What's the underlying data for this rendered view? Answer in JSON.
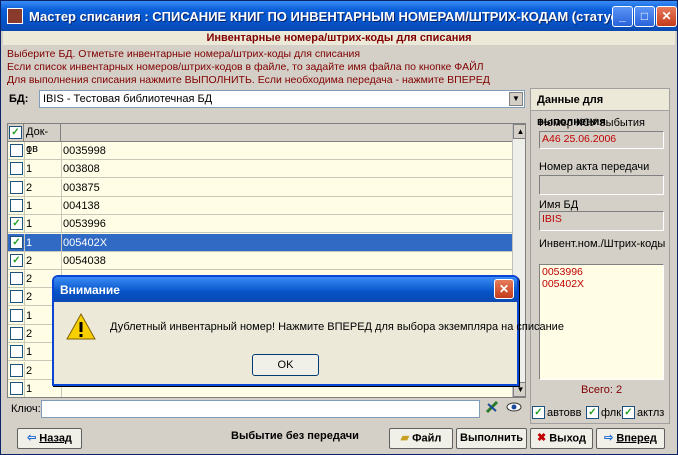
{
  "window": {
    "title": "Мастер списания : СПИСАНИЕ КНИГ ПО ИНВЕНТАРНЫМ НОМЕРАМ/ШТРИХ-КОДАМ (статус 0)",
    "min_label": "_",
    "max_label": "□",
    "close_label": "✕"
  },
  "header": "Инвентарные номера/штрих-коды для списания",
  "instructions": [
    "Выберите БД. Отметьте инвентарные номера/штрих-коды для списания",
    "Если список инвентарных номеров/штрих-кодов  в файле, то задайте имя файла по кнопке ФАЙЛ",
    "Для выполнения списания нажмите ВЫПОЛНИТЬ. Если необходима передача - нажмите ВПЕРЕД"
  ],
  "db": {
    "label": "БД:",
    "value": "IBIS - Тестовая библиотечная БД"
  },
  "grid": {
    "col_check": "✓",
    "col_docs": "Док-ов",
    "rows": [
      {
        "checked": false,
        "docs": "1",
        "inv": "0035998",
        "selected": false
      },
      {
        "checked": false,
        "docs": "1",
        "inv": "003808",
        "selected": false
      },
      {
        "checked": false,
        "docs": "2",
        "inv": "003875",
        "selected": false
      },
      {
        "checked": false,
        "docs": "1",
        "inv": "004138",
        "selected": false
      },
      {
        "checked": true,
        "docs": "1",
        "inv": "0053996",
        "selected": false
      },
      {
        "checked": true,
        "docs": "1",
        "inv": "005402X",
        "selected": true
      },
      {
        "checked": true,
        "docs": "2",
        "inv": "0054038",
        "selected": false
      },
      {
        "checked": false,
        "docs": "2",
        "inv": "",
        "selected": false
      },
      {
        "checked": false,
        "docs": "2",
        "inv": "",
        "selected": false
      },
      {
        "checked": false,
        "docs": "1",
        "inv": "",
        "selected": false
      },
      {
        "checked": false,
        "docs": "2",
        "inv": "",
        "selected": false
      },
      {
        "checked": false,
        "docs": "1",
        "inv": "",
        "selected": false
      },
      {
        "checked": false,
        "docs": "2",
        "inv": "",
        "selected": false
      },
      {
        "checked": false,
        "docs": "1",
        "inv": "",
        "selected": false
      }
    ]
  },
  "key": {
    "label": "Ключ:",
    "value": ""
  },
  "right_panel": {
    "title": "Данные для выполнения",
    "ksu_label": "Номер КСУ выбытия",
    "ksu_value": "А46 25.06.2006",
    "act_label": "Номер акта передачи",
    "act_value": "",
    "db_label": "Имя БД",
    "db_value": "IBIS",
    "inv_label": "Инвент.ном./Штрих-коды",
    "inv_values": [
      "0053996",
      "005402X"
    ],
    "total": "Всего:  2"
  },
  "options": [
    {
      "label": "автовв",
      "checked": true
    },
    {
      "label": "флк",
      "checked": true
    },
    {
      "label": "актлз",
      "checked": true
    }
  ],
  "buttons": {
    "back": "Назад",
    "status": "Выбытие без передачи",
    "file": "Файл",
    "execute": "Выполнить",
    "exit": "Выход",
    "forward": "Вперед"
  },
  "dialog": {
    "title": "Внимание",
    "message": "Дублетный инвентарный номер! Нажмите ВПЕРЕД для выбора экземпляра на списание",
    "ok": "OK",
    "close": "✕"
  },
  "colors": {
    "accent": "#0a5fd8",
    "selection": "#316ac5",
    "text_red": "#c00000",
    "grid_bg": "#fffde5"
  }
}
